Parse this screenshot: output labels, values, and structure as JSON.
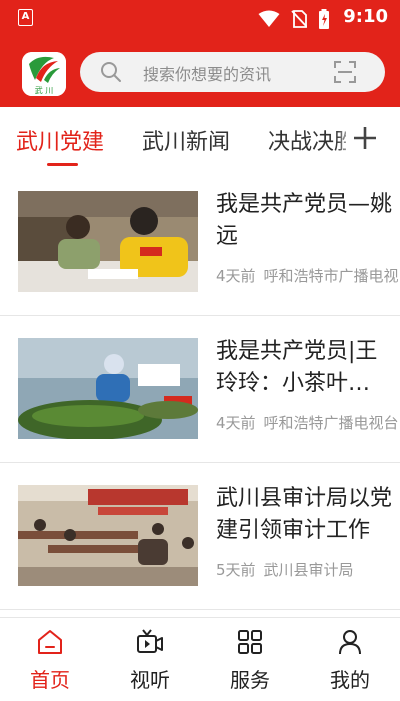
{
  "status_bar": {
    "left_icon": "A",
    "time": "9:10"
  },
  "header": {
    "logo_text": "武 川",
    "search_placeholder": "搜索你想要的资讯"
  },
  "tabs": [
    {
      "label": "武川党建",
      "active": true
    },
    {
      "label": "武川新闻",
      "active": false
    },
    {
      "label": "决战决胜",
      "active": false
    }
  ],
  "news": [
    {
      "title": "我是共产党员—姚远",
      "age": "4天前",
      "source": "呼和浩特市广播电视台"
    },
    {
      "title": "我是共产党员|王玲玲：小茶叶大产业",
      "age": "4天前",
      "source": "呼和浩特广播电视台"
    },
    {
      "title": "武川县审计局以党建引领审计工作",
      "age": "5天前",
      "source": "武川县审计局"
    }
  ],
  "bottom_nav": [
    {
      "label": "首页",
      "icon": "home-icon",
      "active": true
    },
    {
      "label": "视听",
      "icon": "video-icon",
      "active": false
    },
    {
      "label": "服务",
      "icon": "grid-icon",
      "active": false
    },
    {
      "label": "我的",
      "icon": "user-icon",
      "active": false
    }
  ],
  "colors": {
    "brand_red": "#e2231a",
    "text_primary": "#222222",
    "text_muted": "#999999"
  }
}
